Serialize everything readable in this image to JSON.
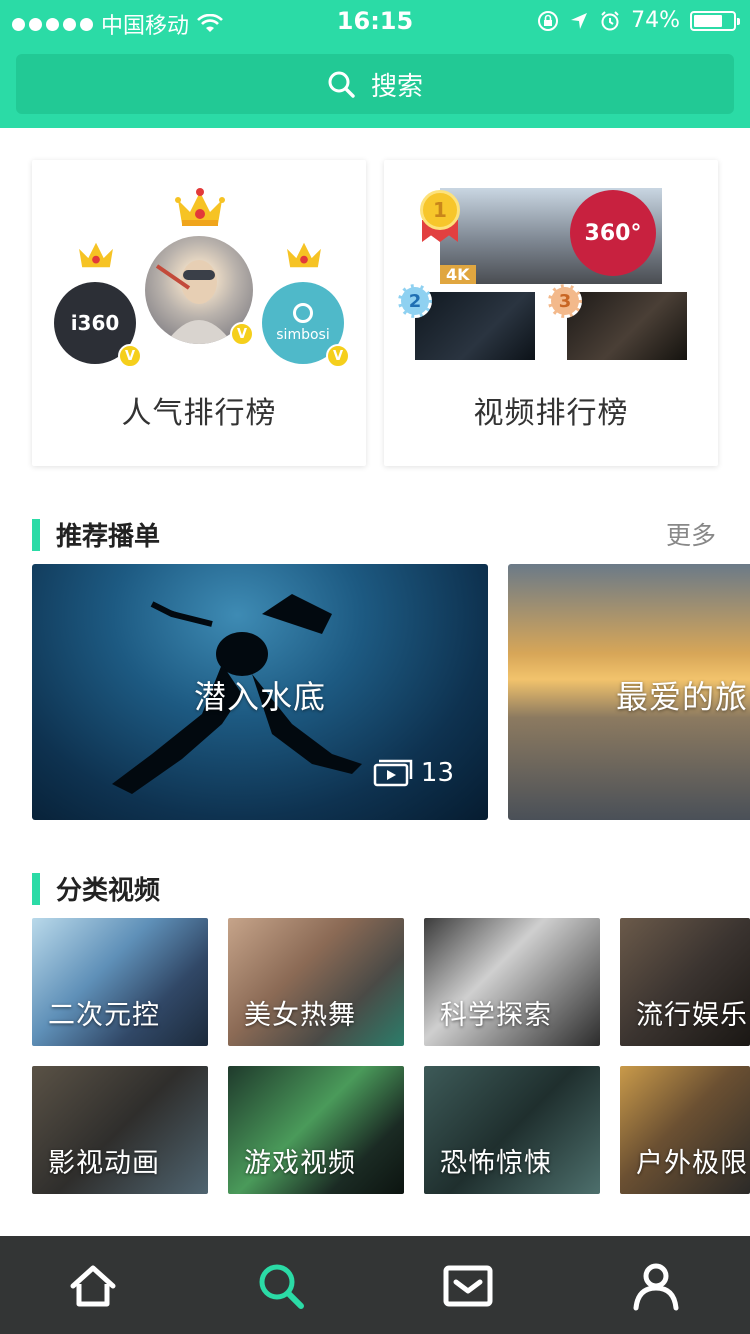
{
  "status_bar": {
    "carrier": "中国移动",
    "time": "16:15",
    "battery": "74%",
    "battery_level": 0.74
  },
  "search": {
    "placeholder": "搜索"
  },
  "rankings": {
    "popularity": {
      "title": "人气排行榜",
      "avatars": [
        "i360",
        "simbosi"
      ],
      "badge": "V"
    },
    "video": {
      "title": "视频排行榜",
      "badge_360": "360°",
      "badge_4k": "4K",
      "ranks": [
        "1",
        "2",
        "3"
      ]
    }
  },
  "playlists": {
    "title": "推荐播单",
    "more": "更多",
    "items": [
      {
        "title": "潜入水底",
        "count": "13"
      },
      {
        "title": "最爱的旅"
      }
    ]
  },
  "categories": {
    "title": "分类视频",
    "items": [
      {
        "label": "二次元控"
      },
      {
        "label": "美女热舞"
      },
      {
        "label": "科学探索"
      },
      {
        "label": "流行娱乐"
      },
      {
        "label": "影视动画"
      },
      {
        "label": "游戏视频"
      },
      {
        "label": "恐怖惊悚"
      },
      {
        "label": "户外极限"
      }
    ]
  },
  "tabbar": {
    "icons": [
      "home-icon",
      "search-icon",
      "inbox-icon",
      "profile-icon"
    ],
    "active_index": 1
  },
  "colors": {
    "brand": "#2bdba6",
    "brand_dark": "#22c995",
    "tabbar_bg": "#333535",
    "tab_active": "#2bdba6",
    "tab_inactive": "#ffffff"
  }
}
